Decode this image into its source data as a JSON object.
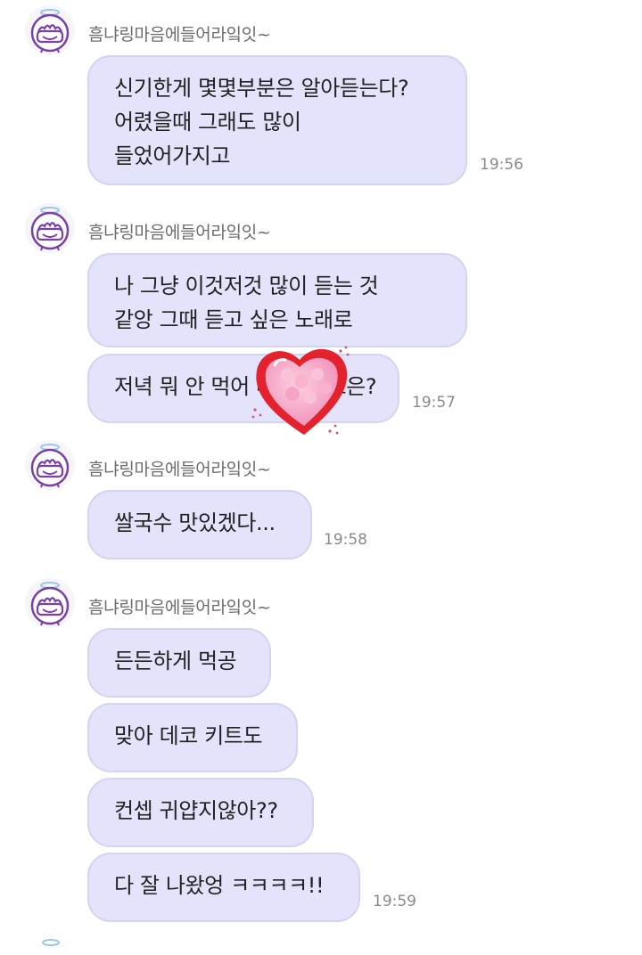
{
  "sender_name": "흠냐링마음에들어라잌잇~",
  "groups": [
    {
      "sender": "흠냐링마음에들어라잌잇~",
      "messages": [
        {
          "text": "신기한게 몇몇부분은 알아듣는다?\n어렸을때 그래도 많이\n들었어가지고",
          "time": "19:56"
        }
      ]
    },
    {
      "sender": "흠냐링마음에들어라잌잇~",
      "messages": [
        {
          "text": "나 그냥 이것저것 많이 듣는 것\n같앙 그때 듣고 싶은 노래로",
          "time": ""
        },
        {
          "text": "저녁 뭐 안 먹어 배 안 고프은?",
          "time": "19:57"
        }
      ]
    },
    {
      "sender": "흠냐링마음에들어라잌잇~",
      "messages": [
        {
          "text": "쌀국수 맛있겠다...",
          "time": "19:58"
        }
      ]
    },
    {
      "sender": "흠냐링마음에들어라잌잇~",
      "messages": [
        {
          "text": "든든하게 먹공",
          "time": ""
        },
        {
          "text": "맞아 데코 키트도",
          "time": ""
        },
        {
          "text": "컨셉 귀얍지않아??",
          "time": ""
        },
        {
          "text": "다 잘 나왔엉 ㅋㅋㅋㅋ!!",
          "time": "19:59"
        }
      ]
    }
  ],
  "sticker": {
    "icon": "pink-heart-sticker",
    "colors": {
      "outer": "#e0202e",
      "inner": "#f79ac0"
    }
  },
  "colors": {
    "bubble": "#e3e3fb",
    "bubble_border": "#d3d3f2",
    "avatar_accent": "#7b3fa8"
  }
}
